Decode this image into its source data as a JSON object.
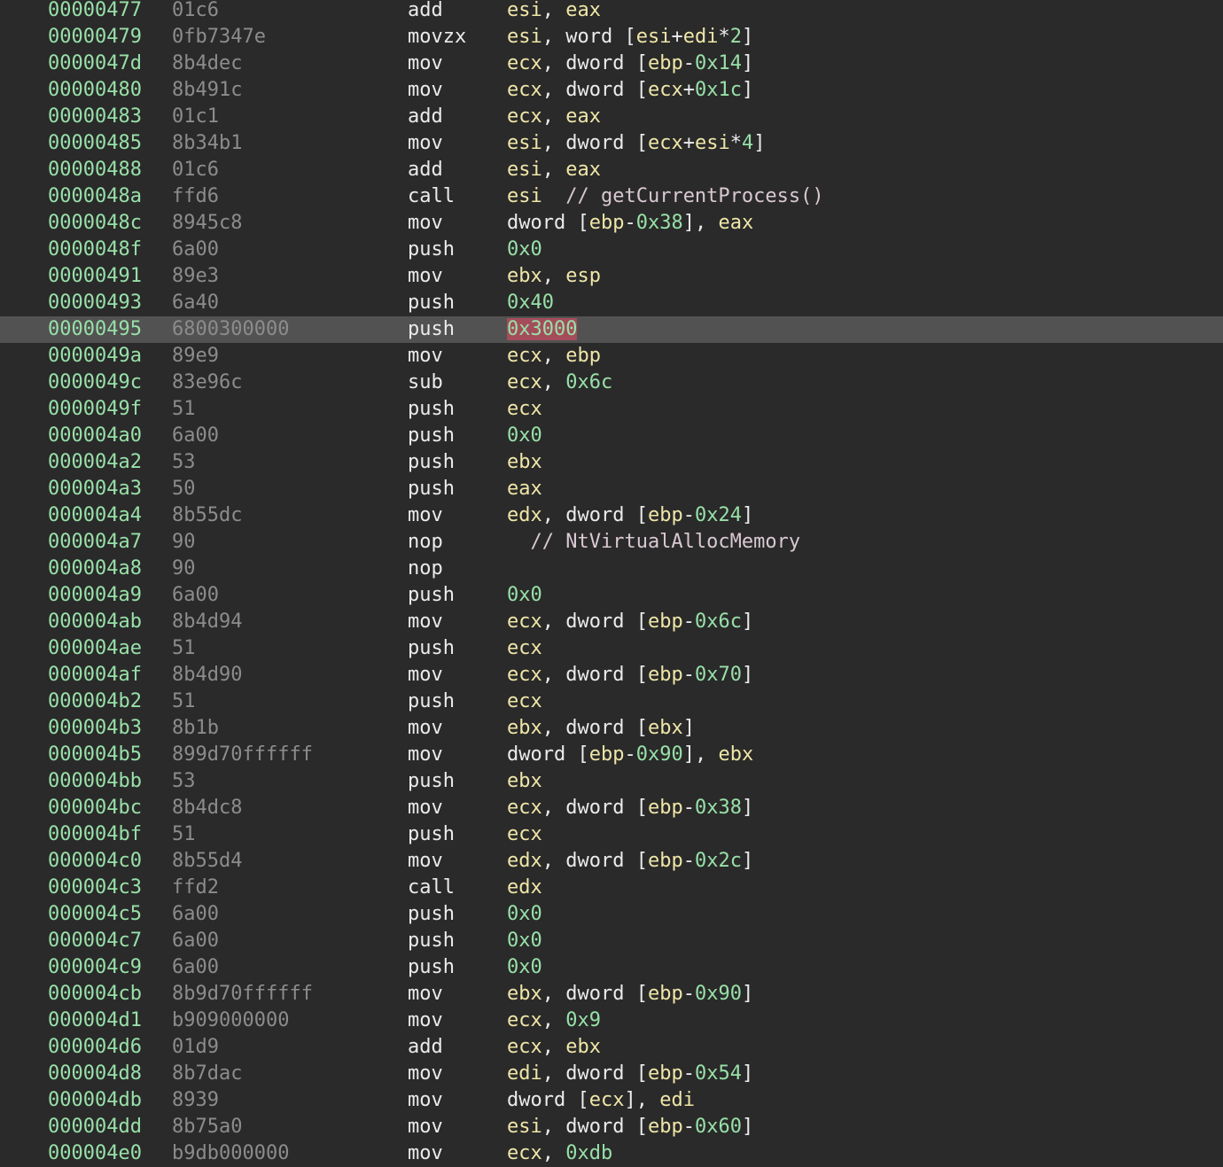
{
  "colors": {
    "background": "#2a2a2a",
    "selected_row": "#525252",
    "address": "#98e0a8",
    "bytes": "#8c8c8c",
    "mnemonic": "#ebebeb",
    "register": "#efe6a8",
    "immediate": "#98e0a8",
    "comment": "#d9c8d2",
    "highlight": "#a44d5a"
  },
  "selected_row_index": 12,
  "instructions": [
    {
      "addr": "00000477",
      "bytes": "01c6",
      "mnemonic": "add",
      "operands": [
        [
          "esi",
          "reg"
        ],
        [
          ", ",
          "p"
        ],
        [
          "eax",
          "reg"
        ]
      ]
    },
    {
      "addr": "00000479",
      "bytes": "0fb7347e",
      "mnemonic": "movzx",
      "operands": [
        [
          "esi",
          "reg"
        ],
        [
          ", ",
          "p"
        ],
        [
          "word",
          "kw"
        ],
        [
          " [",
          "p"
        ],
        [
          "esi",
          "reg"
        ],
        [
          "+",
          "p"
        ],
        [
          "edi",
          "reg"
        ],
        [
          "*",
          "p"
        ],
        [
          "2",
          "imm"
        ],
        [
          "]",
          "p"
        ]
      ]
    },
    {
      "addr": "0000047d",
      "bytes": "8b4dec",
      "mnemonic": "mov",
      "operands": [
        [
          "ecx",
          "reg"
        ],
        [
          ", ",
          "p"
        ],
        [
          "dword",
          "kw"
        ],
        [
          " [",
          "p"
        ],
        [
          "ebp",
          "reg"
        ],
        [
          "-",
          "p"
        ],
        [
          "0x14",
          "imm"
        ],
        [
          "]",
          "p"
        ]
      ]
    },
    {
      "addr": "00000480",
      "bytes": "8b491c",
      "mnemonic": "mov",
      "operands": [
        [
          "ecx",
          "reg"
        ],
        [
          ", ",
          "p"
        ],
        [
          "dword",
          "kw"
        ],
        [
          " [",
          "p"
        ],
        [
          "ecx",
          "reg"
        ],
        [
          "+",
          "p"
        ],
        [
          "0x1c",
          "imm"
        ],
        [
          "]",
          "p"
        ]
      ]
    },
    {
      "addr": "00000483",
      "bytes": "01c1",
      "mnemonic": "add",
      "operands": [
        [
          "ecx",
          "reg"
        ],
        [
          ", ",
          "p"
        ],
        [
          "eax",
          "reg"
        ]
      ]
    },
    {
      "addr": "00000485",
      "bytes": "8b34b1",
      "mnemonic": "mov",
      "operands": [
        [
          "esi",
          "reg"
        ],
        [
          ", ",
          "p"
        ],
        [
          "dword",
          "kw"
        ],
        [
          " [",
          "p"
        ],
        [
          "ecx",
          "reg"
        ],
        [
          "+",
          "p"
        ],
        [
          "esi",
          "reg"
        ],
        [
          "*",
          "p"
        ],
        [
          "4",
          "imm"
        ],
        [
          "]",
          "p"
        ]
      ]
    },
    {
      "addr": "00000488",
      "bytes": "01c6",
      "mnemonic": "add",
      "operands": [
        [
          "esi",
          "reg"
        ],
        [
          ", ",
          "p"
        ],
        [
          "eax",
          "reg"
        ]
      ]
    },
    {
      "addr": "0000048a",
      "bytes": "ffd6",
      "mnemonic": "call",
      "operands": [
        [
          "esi",
          "reg"
        ],
        [
          "  // getCurrentProcess()",
          "c"
        ]
      ]
    },
    {
      "addr": "0000048c",
      "bytes": "8945c8",
      "mnemonic": "mov",
      "operands": [
        [
          "dword",
          "kw"
        ],
        [
          " [",
          "p"
        ],
        [
          "ebp",
          "reg"
        ],
        [
          "-",
          "p"
        ],
        [
          "0x38",
          "imm"
        ],
        [
          "], ",
          "p"
        ],
        [
          "eax",
          "reg"
        ]
      ]
    },
    {
      "addr": "0000048f",
      "bytes": "6a00",
      "mnemonic": "push",
      "operands": [
        [
          "0x0",
          "imm"
        ]
      ]
    },
    {
      "addr": "00000491",
      "bytes": "89e3",
      "mnemonic": "mov",
      "operands": [
        [
          "ebx",
          "reg"
        ],
        [
          ", ",
          "p"
        ],
        [
          "esp",
          "reg"
        ]
      ]
    },
    {
      "addr": "00000493",
      "bytes": "6a40",
      "mnemonic": "push",
      "operands": [
        [
          "0x40",
          "imm"
        ]
      ]
    },
    {
      "addr": "00000495",
      "bytes": "6800300000",
      "mnemonic": "push",
      "operands": [
        [
          "0x3000",
          "hl"
        ]
      ]
    },
    {
      "addr": "0000049a",
      "bytes": "89e9",
      "mnemonic": "mov",
      "operands": [
        [
          "ecx",
          "reg"
        ],
        [
          ", ",
          "p"
        ],
        [
          "ebp",
          "reg"
        ]
      ]
    },
    {
      "addr": "0000049c",
      "bytes": "83e96c",
      "mnemonic": "sub",
      "operands": [
        [
          "ecx",
          "reg"
        ],
        [
          ", ",
          "p"
        ],
        [
          "0x6c",
          "imm"
        ]
      ]
    },
    {
      "addr": "0000049f",
      "bytes": "51",
      "mnemonic": "push",
      "operands": [
        [
          "ecx",
          "reg"
        ]
      ]
    },
    {
      "addr": "000004a0",
      "bytes": "6a00",
      "mnemonic": "push",
      "operands": [
        [
          "0x0",
          "imm"
        ]
      ]
    },
    {
      "addr": "000004a2",
      "bytes": "53",
      "mnemonic": "push",
      "operands": [
        [
          "ebx",
          "reg"
        ]
      ]
    },
    {
      "addr": "000004a3",
      "bytes": "50",
      "mnemonic": "push",
      "operands": [
        [
          "eax",
          "reg"
        ]
      ]
    },
    {
      "addr": "000004a4",
      "bytes": "8b55dc",
      "mnemonic": "mov",
      "operands": [
        [
          "edx",
          "reg"
        ],
        [
          ", ",
          "p"
        ],
        [
          "dword",
          "kw"
        ],
        [
          " [",
          "p"
        ],
        [
          "ebp",
          "reg"
        ],
        [
          "-",
          "p"
        ],
        [
          "0x24",
          "imm"
        ],
        [
          "]",
          "p"
        ]
      ]
    },
    {
      "addr": "000004a7",
      "bytes": "90",
      "mnemonic": "nop",
      "operands": [
        [
          "  // NtVirtualAllocMemory",
          "c"
        ]
      ]
    },
    {
      "addr": "000004a8",
      "bytes": "90",
      "mnemonic": "nop",
      "operands": []
    },
    {
      "addr": "000004a9",
      "bytes": "6a00",
      "mnemonic": "push",
      "operands": [
        [
          "0x0",
          "imm"
        ]
      ]
    },
    {
      "addr": "000004ab",
      "bytes": "8b4d94",
      "mnemonic": "mov",
      "operands": [
        [
          "ecx",
          "reg"
        ],
        [
          ", ",
          "p"
        ],
        [
          "dword",
          "kw"
        ],
        [
          " [",
          "p"
        ],
        [
          "ebp",
          "reg"
        ],
        [
          "-",
          "p"
        ],
        [
          "0x6c",
          "imm"
        ],
        [
          "]",
          "p"
        ]
      ]
    },
    {
      "addr": "000004ae",
      "bytes": "51",
      "mnemonic": "push",
      "operands": [
        [
          "ecx",
          "reg"
        ]
      ]
    },
    {
      "addr": "000004af",
      "bytes": "8b4d90",
      "mnemonic": "mov",
      "operands": [
        [
          "ecx",
          "reg"
        ],
        [
          ", ",
          "p"
        ],
        [
          "dword",
          "kw"
        ],
        [
          " [",
          "p"
        ],
        [
          "ebp",
          "reg"
        ],
        [
          "-",
          "p"
        ],
        [
          "0x70",
          "imm"
        ],
        [
          "]",
          "p"
        ]
      ]
    },
    {
      "addr": "000004b2",
      "bytes": "51",
      "mnemonic": "push",
      "operands": [
        [
          "ecx",
          "reg"
        ]
      ]
    },
    {
      "addr": "000004b3",
      "bytes": "8b1b",
      "mnemonic": "mov",
      "operands": [
        [
          "ebx",
          "reg"
        ],
        [
          ", ",
          "p"
        ],
        [
          "dword",
          "kw"
        ],
        [
          " [",
          "p"
        ],
        [
          "ebx",
          "reg"
        ],
        [
          "]",
          "p"
        ]
      ]
    },
    {
      "addr": "000004b5",
      "bytes": "899d70ffffff",
      "mnemonic": "mov",
      "operands": [
        [
          "dword",
          "kw"
        ],
        [
          " [",
          "p"
        ],
        [
          "ebp",
          "reg"
        ],
        [
          "-",
          "p"
        ],
        [
          "0x90",
          "imm"
        ],
        [
          "], ",
          "p"
        ],
        [
          "ebx",
          "reg"
        ]
      ]
    },
    {
      "addr": "000004bb",
      "bytes": "53",
      "mnemonic": "push",
      "operands": [
        [
          "ebx",
          "reg"
        ]
      ]
    },
    {
      "addr": "000004bc",
      "bytes": "8b4dc8",
      "mnemonic": "mov",
      "operands": [
        [
          "ecx",
          "reg"
        ],
        [
          ", ",
          "p"
        ],
        [
          "dword",
          "kw"
        ],
        [
          " [",
          "p"
        ],
        [
          "ebp",
          "reg"
        ],
        [
          "-",
          "p"
        ],
        [
          "0x38",
          "imm"
        ],
        [
          "]",
          "p"
        ]
      ]
    },
    {
      "addr": "000004bf",
      "bytes": "51",
      "mnemonic": "push",
      "operands": [
        [
          "ecx",
          "reg"
        ]
      ]
    },
    {
      "addr": "000004c0",
      "bytes": "8b55d4",
      "mnemonic": "mov",
      "operands": [
        [
          "edx",
          "reg"
        ],
        [
          ", ",
          "p"
        ],
        [
          "dword",
          "kw"
        ],
        [
          " [",
          "p"
        ],
        [
          "ebp",
          "reg"
        ],
        [
          "-",
          "p"
        ],
        [
          "0x2c",
          "imm"
        ],
        [
          "]",
          "p"
        ]
      ]
    },
    {
      "addr": "000004c3",
      "bytes": "ffd2",
      "mnemonic": "call",
      "operands": [
        [
          "edx",
          "reg"
        ]
      ]
    },
    {
      "addr": "000004c5",
      "bytes": "6a00",
      "mnemonic": "push",
      "operands": [
        [
          "0x0",
          "imm"
        ]
      ]
    },
    {
      "addr": "000004c7",
      "bytes": "6a00",
      "mnemonic": "push",
      "operands": [
        [
          "0x0",
          "imm"
        ]
      ]
    },
    {
      "addr": "000004c9",
      "bytes": "6a00",
      "mnemonic": "push",
      "operands": [
        [
          "0x0",
          "imm"
        ]
      ]
    },
    {
      "addr": "000004cb",
      "bytes": "8b9d70ffffff",
      "mnemonic": "mov",
      "operands": [
        [
          "ebx",
          "reg"
        ],
        [
          ", ",
          "p"
        ],
        [
          "dword",
          "kw"
        ],
        [
          " [",
          "p"
        ],
        [
          "ebp",
          "reg"
        ],
        [
          "-",
          "p"
        ],
        [
          "0x90",
          "imm"
        ],
        [
          "]",
          "p"
        ]
      ]
    },
    {
      "addr": "000004d1",
      "bytes": "b909000000",
      "mnemonic": "mov",
      "operands": [
        [
          "ecx",
          "reg"
        ],
        [
          ", ",
          "p"
        ],
        [
          "0x9",
          "imm"
        ]
      ]
    },
    {
      "addr": "000004d6",
      "bytes": "01d9",
      "mnemonic": "add",
      "operands": [
        [
          "ecx",
          "reg"
        ],
        [
          ", ",
          "p"
        ],
        [
          "ebx",
          "reg"
        ]
      ]
    },
    {
      "addr": "000004d8",
      "bytes": "8b7dac",
      "mnemonic": "mov",
      "operands": [
        [
          "edi",
          "reg"
        ],
        [
          ", ",
          "p"
        ],
        [
          "dword",
          "kw"
        ],
        [
          " [",
          "p"
        ],
        [
          "ebp",
          "reg"
        ],
        [
          "-",
          "p"
        ],
        [
          "0x54",
          "imm"
        ],
        [
          "]",
          "p"
        ]
      ]
    },
    {
      "addr": "000004db",
      "bytes": "8939",
      "mnemonic": "mov",
      "operands": [
        [
          "dword",
          "kw"
        ],
        [
          " [",
          "p"
        ],
        [
          "ecx",
          "reg"
        ],
        [
          "], ",
          "p"
        ],
        [
          "edi",
          "reg"
        ]
      ]
    },
    {
      "addr": "000004dd",
      "bytes": "8b75a0",
      "mnemonic": "mov",
      "operands": [
        [
          "esi",
          "reg"
        ],
        [
          ", ",
          "p"
        ],
        [
          "dword",
          "kw"
        ],
        [
          " [",
          "p"
        ],
        [
          "ebp",
          "reg"
        ],
        [
          "-",
          "p"
        ],
        [
          "0x60",
          "imm"
        ],
        [
          "]",
          "p"
        ]
      ]
    },
    {
      "addr": "000004e0",
      "bytes": "b9db000000",
      "mnemonic": "mov",
      "operands": [
        [
          "ecx",
          "reg"
        ],
        [
          ", ",
          "p"
        ],
        [
          "0xdb",
          "imm"
        ]
      ]
    }
  ]
}
